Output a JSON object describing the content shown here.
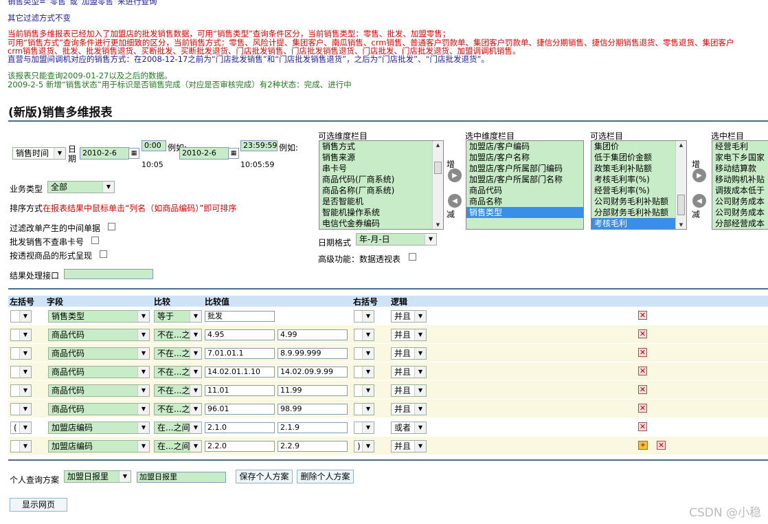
{
  "notes": {
    "line1": "销售类型=“零售”或“加盟零售”来进行查询",
    "line2": "其它过滤方式不变",
    "red1": "当前销售多维报表已经加入了加盟店的批发销售数据，可用“销售类型”查询条件区分，当前销售类型：零售、批发、加盟零售；",
    "red2": "可用“销售方式”查询条件进行更加细致的区分，当前销售方式：零售、风险计提、集团客户、南瓜销售、crm销售、普通客户罚款单、集团客户罚款单、捷信分期销售、捷信分期销售退货、零售退货、集团客户",
    "red3": "crm销售退货、批发、批发销售退货、买断批发、买断批发退货、门店批发销售、门店批发销售退货、门店批发、门店批发退货、加盟调调机销售。",
    "blue3": "直营与加盟间调机对应的销售方式：在2008-12-17之前为“门店批发销售”和“门店批发销售退货”，之后为“门店批发”、“门店批发退货”。",
    "green1": "该报表只能查询2009-01-27以及之后的数据。",
    "green2": "2009-2-5 新增“销售状态”用于标识是否销售完成（对应是否审核完成）有2种状态：完成、进行中"
  },
  "page_title": "(新版)销售多维报表",
  "filters": {
    "date_type": "销售时间",
    "date_label": "日期",
    "start_date": "2010-2-6",
    "start_time": "0:00",
    "start_example_label": "例如:",
    "start_example_value": "10:05",
    "end_date": "2010-2-6",
    "end_time": "23:59:59",
    "end_example_label": "例如:",
    "end_example_value": "10:05:59",
    "business_type_label": "业务类型",
    "business_type_value": "全部",
    "sort_label": "排序方式",
    "sort_hint": "在报表结果中鼠标单击“列名（如商品编码）”即可排序",
    "filter_change_label": "过滤改单产生的中间单据",
    "no_serial_label": "批发销售不查串卡号",
    "pivot_label": "按透视商品的形式呈现",
    "result_interface_label": "结果处理接口",
    "date_format_label": "日期格式",
    "date_format_value": "年-月-日",
    "advanced_label": "高级功能：数据透视表"
  },
  "dims": {
    "avail_title": "可选维度栏目",
    "avail_items": [
      "销售方式",
      "销售来源",
      "串卡号",
      "商品代码(厂商系统)",
      "商品名称(厂商系统)",
      "是否智能机",
      "智能机操作系统",
      "电信代金券编码"
    ],
    "selected_title": "选中维度栏目",
    "selected_items": [
      "加盟店/客户编码",
      "加盟店/客户名称",
      "加盟店/客户所属部门编码",
      "加盟店/客户所属部门名称",
      "商品代码",
      "商品名称",
      "销售类型"
    ],
    "add_label": "增",
    "remove_label": "减"
  },
  "cols": {
    "avail_title": "可选栏目",
    "avail_items": [
      "集团价",
      "低于集团价金额",
      "政策毛利补贴额",
      "考核毛利率(%)",
      "经营毛利率(%)",
      "公司财务毛利补贴额",
      "分部财务毛利补贴额",
      "考核毛利"
    ],
    "selected_title": "选中栏目",
    "selected_items": [
      "经营毛利",
      "家电下乡国家",
      "移动结算款",
      "移动购机补贴",
      "调拨成本低于",
      "公司财务成本",
      "公司财务成本",
      "分部经营成本"
    ],
    "add_label": "增",
    "remove_label": "减"
  },
  "table": {
    "headers": [
      "左括号",
      "字段",
      "比较",
      "比较值",
      "右括号",
      "逻辑"
    ],
    "rows": [
      {
        "lp": "",
        "field": "销售类型",
        "op": "等于",
        "v1": "批发",
        "v2": "",
        "rp": "",
        "logic": "并且"
      },
      {
        "lp": "",
        "field": "商品代码",
        "op": "不在...之",
        "v1": "4.95",
        "v2": "4.99",
        "rp": "",
        "logic": "并且"
      },
      {
        "lp": "",
        "field": "商品代码",
        "op": "不在...之",
        "v1": "7.01.01.1",
        "v2": "8.9.99.999",
        "rp": "",
        "logic": "并且"
      },
      {
        "lp": "",
        "field": "商品代码",
        "op": "不在...之",
        "v1": "14.02.01.1.10",
        "v2": "14.02.09.9.99",
        "rp": "",
        "logic": "并且"
      },
      {
        "lp": "",
        "field": "商品代码",
        "op": "不在...之",
        "v1": "11.01",
        "v2": "11.99",
        "rp": "",
        "logic": "并且"
      },
      {
        "lp": "",
        "field": "商品代码",
        "op": "不在...之",
        "v1": "96.01",
        "v2": "98.99",
        "rp": "",
        "logic": "并且"
      },
      {
        "lp": "(",
        "field": "加盟店编码",
        "op": "在...之间",
        "v1": "2.1.0",
        "v2": "2.1.9",
        "rp": "",
        "logic": "或者"
      },
      {
        "lp": "",
        "field": "加盟店编码",
        "op": "在...之间",
        "v1": "2.2.0",
        "v2": "2.2.9",
        "rp": ")",
        "logic": "并且"
      }
    ]
  },
  "bottom": {
    "scheme_label": "个人查询方案",
    "scheme_value": "加盟日报里",
    "scheme_name": "加盟日报里",
    "save_label": "保存个人方案",
    "delete_label": "删除个人方案",
    "show_label": "显示网页"
  },
  "watermark": "CSDN @小稳"
}
